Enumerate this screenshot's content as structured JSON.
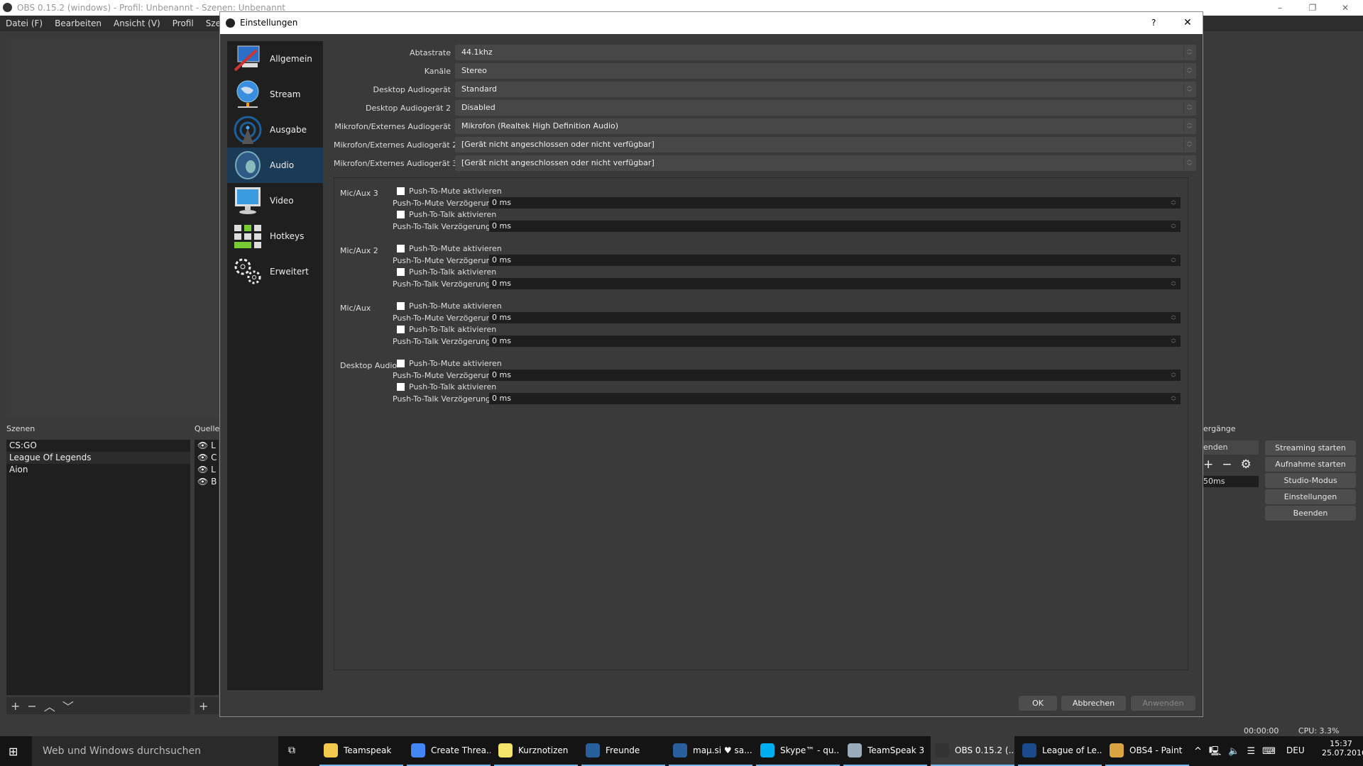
{
  "app": {
    "title": "OBS 0.15.2 (windows) - Profil: Unbenannt - Szenen: Unbenannt",
    "menu": [
      "Datei (F)",
      "Bearbeiten",
      "Ansicht (V)",
      "Profil",
      "Szenen-S"
    ],
    "window_controls": {
      "minimize": "–",
      "maximize": "❐",
      "close": "✕"
    },
    "scenes": {
      "label": "Szenen",
      "items": [
        "CS:GO",
        "League Of Legends",
        "Aion"
      ],
      "selected": 1
    },
    "sources": {
      "label": "Quellen",
      "items": [
        "L",
        "C",
        "L",
        "B"
      ]
    },
    "transitions": {
      "label": "ergänge",
      "select_value": "enden",
      "duration": "50ms"
    },
    "controls": [
      "Streaming starten",
      "Aufnahme starten",
      "Studio-Modus",
      "Einstellungen",
      "Beenden"
    ],
    "status": {
      "time": "00:00:00",
      "cpu": "CPU: 3.3%"
    }
  },
  "dialog": {
    "title": "Einstellungen",
    "help": "?",
    "close": "✕",
    "sidebar": [
      {
        "label": "Allgemein",
        "icon": "computer-tools-icon"
      },
      {
        "label": "Stream",
        "icon": "globe-icon"
      },
      {
        "label": "Ausgabe",
        "icon": "broadcast-icon"
      },
      {
        "label": "Audio",
        "icon": "speaker-icon",
        "active": true
      },
      {
        "label": "Video",
        "icon": "monitor-icon"
      },
      {
        "label": "Hotkeys",
        "icon": "keyboard-icon"
      },
      {
        "label": "Erweitert",
        "icon": "gears-icon"
      }
    ],
    "fields": [
      {
        "label": "Abtastrate",
        "value": "44.1khz"
      },
      {
        "label": "Kanäle",
        "value": "Stereo"
      },
      {
        "label": "Desktop Audiogerät",
        "value": "Standard"
      },
      {
        "label": "Desktop Audiogerät 2",
        "value": "Disabled"
      },
      {
        "label": "Mikrofon/Externes Audiogerät",
        "value": "Mikrofon (Realtek High Definition Audio)"
      },
      {
        "label": "Mikrofon/Externes Audiogerät 2",
        "value": "[Gerät nicht angeschlossen oder nicht verfügbar]"
      },
      {
        "label": "Mikrofon/Externes Audiogerät 3",
        "value": "[Gerät nicht angeschlossen oder nicht verfügbar]"
      }
    ],
    "hotkey_groups": [
      {
        "name": "Mic/Aux 3",
        "ptm_label": "Push-To-Mute aktivieren",
        "ptm_checked": false,
        "ptm_delay_label": "Push-To-Mute Verzögerung",
        "ptm_delay": "0 ms",
        "ptt_label": "Push-To-Talk aktivieren",
        "ptt_checked": false,
        "ptt_delay_label": "Push-To-Talk Verzögerung",
        "ptt_delay": "0 ms"
      },
      {
        "name": "Mic/Aux 2",
        "ptm_label": "Push-To-Mute aktivieren",
        "ptm_checked": false,
        "ptm_delay_label": "Push-To-Mute Verzögerung",
        "ptm_delay": "0 ms",
        "ptt_label": "Push-To-Talk aktivieren",
        "ptt_checked": false,
        "ptt_delay_label": "Push-To-Talk Verzögerung",
        "ptt_delay": "0 ms"
      },
      {
        "name": "Mic/Aux",
        "ptm_label": "Push-To-Mute aktivieren",
        "ptm_checked": false,
        "ptm_delay_label": "Push-To-Mute Verzögerung",
        "ptm_delay": "0 ms",
        "ptt_label": "Push-To-Talk aktivieren",
        "ptt_checked": false,
        "ptt_delay_label": "Push-To-Talk Verzögerung",
        "ptt_delay": "0 ms"
      },
      {
        "name": "Desktop Audio",
        "ptm_label": "Push-To-Mute aktivieren",
        "ptm_checked": false,
        "ptm_delay_label": "Push-To-Mute Verzögerung",
        "ptm_delay": "0 ms",
        "ptt_label": "Push-To-Talk aktivieren",
        "ptt_checked": false,
        "ptt_delay_label": "Push-To-Talk Verzögerung",
        "ptt_delay": "0 ms"
      }
    ],
    "buttons": {
      "ok": "OK",
      "cancel": "Abbrechen",
      "apply": "Anwenden"
    }
  },
  "taskbar": {
    "search_placeholder": "Web und Windows durchsuchen",
    "items": [
      {
        "label": "Teamspeak",
        "color": "#f2c94c"
      },
      {
        "label": "Create Threa...",
        "color": "#4285f4"
      },
      {
        "label": "Kurznotizen",
        "color": "#f5e66a"
      },
      {
        "label": "Freunde",
        "color": "#2a5f9e"
      },
      {
        "label": "maµ.si ♥ sa...",
        "color": "#2a5f9e"
      },
      {
        "label": "Skype™ - qu...",
        "color": "#00aff0"
      },
      {
        "label": "TeamSpeak 3",
        "color": "#9ab"
      },
      {
        "label": "OBS 0.15.2 (...",
        "color": "#333",
        "active": true
      },
      {
        "label": "League of Le...",
        "color": "#1b4a8a"
      },
      {
        "label": "OBS4 - Paint",
        "color": "#d9a441"
      }
    ],
    "tray": {
      "language": "DEU",
      "time": "15:37",
      "date": "25.07.2016"
    }
  }
}
